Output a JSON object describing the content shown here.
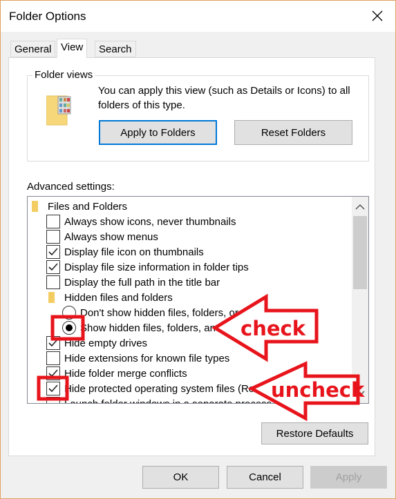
{
  "window": {
    "title": "Folder Options"
  },
  "tabs": [
    {
      "label": "General"
    },
    {
      "label": "View",
      "active": true
    },
    {
      "label": "Search"
    }
  ],
  "folder_views": {
    "label": "Folder views",
    "description": "You can apply this view (such as Details or Icons) to all folders of this type.",
    "apply_button": "Apply to Folders",
    "reset_button": "Reset Folders"
  },
  "advanced": {
    "label": "Advanced settings:",
    "items": [
      {
        "type": "folder",
        "label": "Files and Folders"
      },
      {
        "type": "checkbox",
        "label": "Always show icons, never thumbnails",
        "checked": false
      },
      {
        "type": "checkbox",
        "label": "Always show menus",
        "checked": false
      },
      {
        "type": "checkbox",
        "label": "Display file icon on thumbnails",
        "checked": true
      },
      {
        "type": "checkbox",
        "label": "Display file size information in folder tips",
        "checked": true
      },
      {
        "type": "checkbox",
        "label": "Display the full path in the title bar",
        "checked": false
      },
      {
        "type": "folder",
        "label": "Hidden files and folders"
      },
      {
        "type": "radio",
        "label": "Don't show hidden files, folders, or drives",
        "checked": false
      },
      {
        "type": "radio",
        "label": "Show hidden files, folders, and drives",
        "checked": true
      },
      {
        "type": "checkbox",
        "label": "Hide empty drives",
        "checked": true
      },
      {
        "type": "checkbox",
        "label": "Hide extensions for known file types",
        "checked": false
      },
      {
        "type": "checkbox",
        "label": "Hide folder merge conflicts",
        "checked": true
      },
      {
        "type": "checkbox",
        "label": "Hide protected operating system files (Recommended)",
        "checked": true
      },
      {
        "type": "checkbox",
        "label": "Launch folder windows in a separate process",
        "checked": false
      }
    ]
  },
  "restore_button": "Restore Defaults",
  "footer": {
    "ok": "OK",
    "cancel": "Cancel",
    "apply": "Apply"
  },
  "annotations": {
    "check": "check",
    "uncheck": "uncheck",
    "color": "#e8141c"
  }
}
